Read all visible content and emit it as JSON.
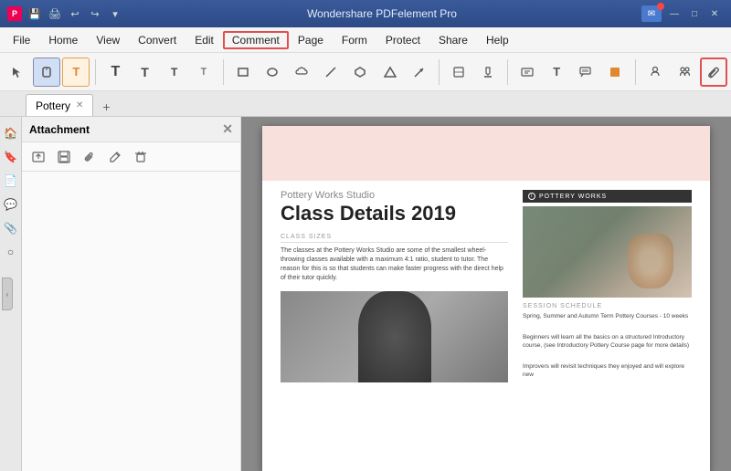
{
  "app": {
    "title": "Wondershare PDFelement Pro"
  },
  "titlebar": {
    "icons": [
      "file",
      "save",
      "print",
      "undo",
      "redo",
      "quick-access"
    ],
    "window_controls": [
      "minimize",
      "maximize",
      "close"
    ]
  },
  "menubar": {
    "items": [
      "File",
      "Home",
      "View",
      "Convert",
      "Edit",
      "Comment",
      "Page",
      "Form",
      "Protect",
      "Share",
      "Help"
    ]
  },
  "toolbar": {
    "tools": [
      {
        "name": "select",
        "icon": "↖"
      },
      {
        "name": "hand",
        "icon": "✋"
      },
      {
        "name": "edit-text",
        "icon": "T"
      },
      {
        "name": "text-box",
        "icon": "T"
      },
      {
        "name": "text-line",
        "icon": "T"
      },
      {
        "name": "text-col",
        "icon": "T"
      },
      {
        "name": "text-para",
        "icon": "T"
      }
    ],
    "shape_tools": [
      {
        "name": "rectangle",
        "icon": "□"
      },
      {
        "name": "circle",
        "icon": "○"
      },
      {
        "name": "cloud",
        "icon": "☁"
      },
      {
        "name": "line",
        "icon": "╱"
      },
      {
        "name": "polygon",
        "icon": "⬡"
      },
      {
        "name": "triangle",
        "icon": "△"
      },
      {
        "name": "arrow",
        "icon": "↗"
      }
    ],
    "markup_tools": [
      {
        "name": "highlight",
        "icon": "◇"
      },
      {
        "name": "strikethrough",
        "icon": "◆"
      }
    ],
    "text_tools": [
      {
        "name": "text-box2",
        "icon": "▤"
      },
      {
        "name": "text-field",
        "icon": "T"
      },
      {
        "name": "callout",
        "icon": "▣"
      },
      {
        "name": "color-box",
        "icon": "■"
      }
    ],
    "other_tools": [
      {
        "name": "stamp",
        "icon": "👤"
      },
      {
        "name": "signature",
        "icon": "✎"
      },
      {
        "name": "attach",
        "icon": "📎"
      }
    ]
  },
  "tabs": {
    "items": [
      {
        "label": "Pottery",
        "active": true
      }
    ],
    "add_label": "+"
  },
  "sidebar": {
    "title": "Attachment",
    "tools": [
      "upload",
      "save",
      "clip",
      "edit",
      "delete"
    ]
  },
  "document": {
    "studio_label": "Pottery Works Studio",
    "main_title": "Class Details 2019",
    "section1_title": "CLASS SIZES",
    "section1_body": "The classes at the Pottery Works Studio are some of the smallest wheel-throwing classes available with a maximum 4:1 ratio, student to tutor. The reason for this is so that students can make faster progress with the direct help of their tutor quickly.",
    "logo_text": "POTTERY WORKS",
    "session_title": "SESSION SCHEDULE",
    "session_text": "Spring, Summer and Autumn Term Pottery Courses - 10 weeks",
    "session_text2": "Beginners will learn all the basics on a structured Introductory course, (see Introductory Pottery Course page for more details)",
    "session_text3": "Improvers will revisit techniques they enjoyed and will explore new"
  }
}
